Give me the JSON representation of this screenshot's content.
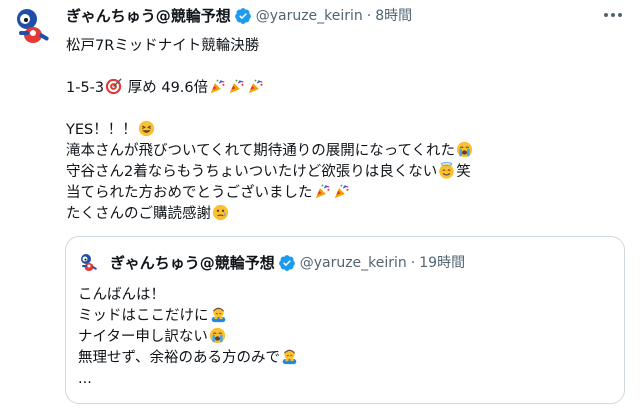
{
  "tweet": {
    "author_name": "ぎゃんちゅう@競輪予想",
    "handle": "@yaruze_keirin",
    "separator": "·",
    "time": "8時間",
    "lines": {
      "l1": "松戸7Rミッドナイト競輪決勝",
      "l2_text": "1-5-3",
      "l2_mid": " 厚め 49.6倍",
      "l3": "YES！！！",
      "l4": "滝本さんが飛びついてくれて期待通りの展開になってくれた",
      "l5": "守谷さん2着ならもうちょいついたけど欲張りは良くない",
      "l5_tail": "笑",
      "l6": "当てられた方おめでとうございました",
      "l7": "たくさんのご購読感謝"
    }
  },
  "quote": {
    "author_name": "ぎゃんちゅう@競輪予想",
    "handle": "@yaruze_keirin",
    "separator": "·",
    "time": "19時間",
    "lines": {
      "l1": "こんばんは！",
      "l2": "ミッドはここだけに",
      "l3": "ナイター申し訳ない",
      "l4": "無理せず、余裕のある方のみで",
      "l5": "..."
    }
  },
  "colors": {
    "text": "#0f1419",
    "secondary": "#536471",
    "verified": "#1d9bf0",
    "border": "#cfd9de"
  },
  "icons": [
    "avatar-mascot",
    "verified-badge",
    "more-dots",
    "direct-hit",
    "party-popper",
    "grinning-squinting",
    "loudly-crying",
    "smiling-halo",
    "face-holding-back-tears",
    "person-bowing"
  ]
}
